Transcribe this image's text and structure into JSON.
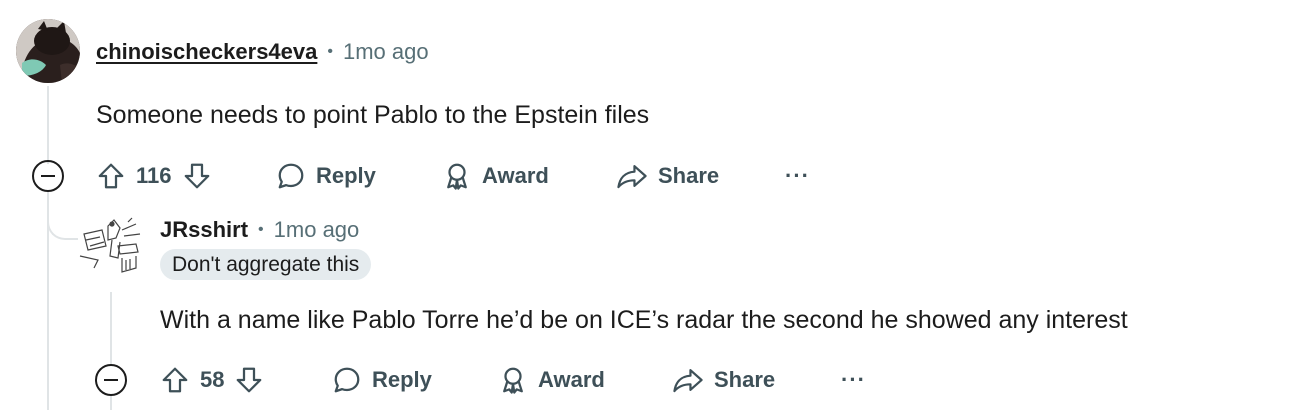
{
  "comments": [
    {
      "username": "chinoischeckers4eva",
      "separator": "•",
      "time": "1mo ago",
      "body": "Someone needs to point Pablo to the Epstein files",
      "votes": "116",
      "reply_label": "Reply",
      "award_label": "Award",
      "share_label": "Share",
      "more_label": "···"
    },
    {
      "username": "JRsshirt",
      "separator": "•",
      "time": "1mo ago",
      "flair": "Don't aggregate this",
      "body": "With a name like Pablo Torre he’d be on ICE’s radar the second he showed any interest",
      "votes": "58",
      "reply_label": "Reply",
      "award_label": "Award",
      "share_label": "Share",
      "more_label": "···"
    }
  ],
  "icons": {
    "upvote": "arrow-up-icon",
    "downvote": "arrow-down-icon",
    "reply": "speech-bubble-icon",
    "award": "award-ribbon-icon",
    "share": "share-arrow-icon",
    "collapse": "minus-circle-icon"
  },
  "colors": {
    "text": "#1c1c1c",
    "muted": "#576f76",
    "action": "#3e5058",
    "thread_line": "#e0e4e6",
    "flair_bg": "#e5ebee"
  }
}
